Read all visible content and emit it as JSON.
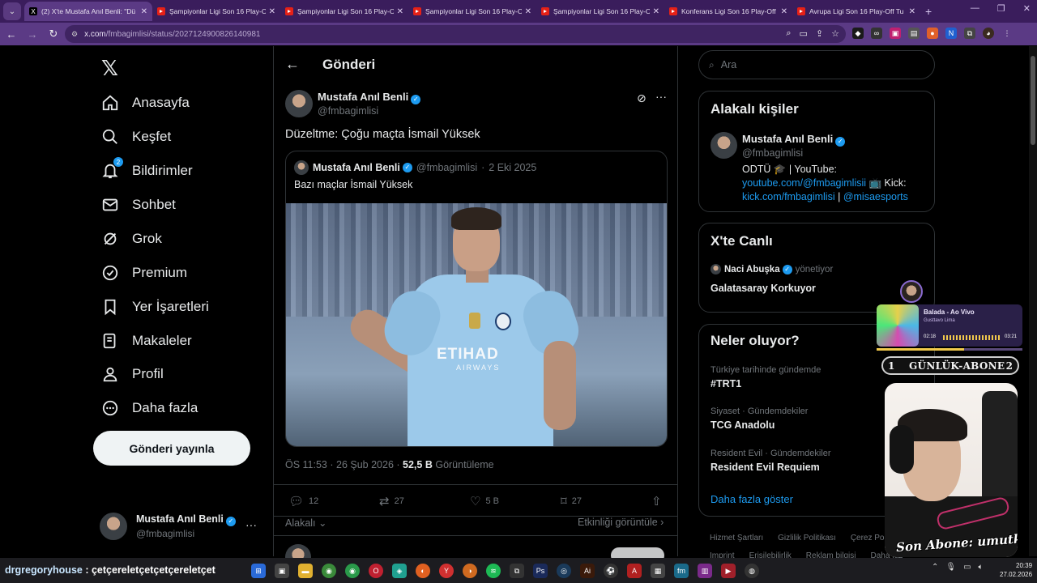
{
  "browser": {
    "tabs": [
      {
        "title": "(2) X'te Mustafa Anıl Benli: \"Dü",
        "favicon": "x-icon",
        "active": true
      },
      {
        "title": "Şampiyonlar Ligi Son 16 Play-O",
        "favicon": "youtube-icon",
        "active": false
      },
      {
        "title": "Şampiyonlar Ligi Son 16 Play-O",
        "favicon": "youtube-icon",
        "active": false
      },
      {
        "title": "Şampiyonlar Ligi Son 16 Play-O",
        "favicon": "youtube-icon",
        "active": false
      },
      {
        "title": "Şampiyonlar Ligi Son 16 Play-O",
        "favicon": "youtube-icon",
        "active": false
      },
      {
        "title": "Konferans Ligi Son 16 Play-Off",
        "favicon": "youtube-icon",
        "active": false
      },
      {
        "title": "Avrupa Ligi Son 16 Play-Off Tu",
        "favicon": "youtube-icon",
        "active": false
      }
    ],
    "url_host": "x.com",
    "url_path": "/fmbagimlisi/status/2027124900826140981",
    "colors": {
      "frame": "#3a1d5c",
      "toolbar": "#5b3a85"
    }
  },
  "nav": {
    "items": [
      {
        "label": "Anasayfa",
        "icon": "home-icon"
      },
      {
        "label": "Keşfet",
        "icon": "search-icon"
      },
      {
        "label": "Bildirimler",
        "icon": "bell-icon",
        "badge": "2"
      },
      {
        "label": "Sohbet",
        "icon": "mail-icon"
      },
      {
        "label": "Grok",
        "icon": "grok-icon"
      },
      {
        "label": "Premium",
        "icon": "premium-icon"
      },
      {
        "label": "Yer İşaretleri",
        "icon": "bookmark-icon"
      },
      {
        "label": "Makaleler",
        "icon": "articles-icon"
      },
      {
        "label": "Profil",
        "icon": "profile-icon"
      },
      {
        "label": "Daha fazla",
        "icon": "more-circle-icon"
      }
    ],
    "post_button": "Gönderi yayınla",
    "account": {
      "name": "Mustafa Anıl Benli",
      "handle": "@fmbagimlisi"
    }
  },
  "main": {
    "header_title": "Gönderi",
    "post": {
      "author_name": "Mustafa Anıl Benli",
      "author_handle": "@fmbagimlisi",
      "text": "Düzeltme: Çoğu maçta İsmail Yüksek",
      "quote": {
        "author_name": "Mustafa Anıl Benli",
        "author_handle": "@fmbagimlisi",
        "date": "2 Eki 2025",
        "text": "Bazı maçlar İsmail Yüksek",
        "photo_sponsor": "ETIHAD",
        "photo_sponsor_sub": "AIRWAYS"
      },
      "time": "ÖS 11:53 · 26 Şub 2026 ·",
      "views_count": "52,5 B",
      "views_label": "Görüntüleme",
      "stats": {
        "replies": "12",
        "reposts": "27",
        "likes": "5 B",
        "bookmarks": "27"
      },
      "related": "Alakalı",
      "activity": "Etkinliği görüntüle"
    }
  },
  "sidebar": {
    "search_placeholder": "Ara",
    "people": {
      "title": "Alakalı kişiler",
      "name": "Mustafa Anıl Benli",
      "handle": "@fmbagimlisi",
      "bio_1": "ODTÜ 🎓 | YouTube:",
      "bio_link_1": "youtube.com/@fmbagimlisii",
      "bio_2": " 📺 Kick:",
      "bio_link_2": "kick.com/fmbagimlisi",
      "bio_sep": " | ",
      "bio_link_3": "@misaesports"
    },
    "live": {
      "title": "X'te Canlı",
      "host": "Naci Abuşka",
      "role": "yönetiyor",
      "space_title": "Galatasaray Korkuyor"
    },
    "trends": {
      "title": "Neler oluyor?",
      "items": [
        {
          "context": "Türkiye tarihinde gündemde",
          "topic": "#TRT1"
        },
        {
          "context": "Siyaset · Gündemdekiler",
          "topic": "TCG Anadolu"
        },
        {
          "context": "Resident Evil · Gündemdekiler",
          "topic": "Resident Evil Requiem"
        }
      ],
      "show_more": "Daha fazla göster"
    },
    "footer": [
      "Hizmet Şartları",
      "Gizlilik Politikası",
      "Çerez Politik",
      "Imprint",
      "Erişilebilirlik",
      "Reklam bilgisi",
      "Daha faz"
    ]
  },
  "overlay": {
    "music": {
      "song": "Balada - Ao Vivo",
      "artist": "Gusttavo Lima",
      "elapsed": "02:18",
      "total": "03:21",
      "progress": 0.6
    },
    "subs": {
      "left": "1",
      "label": "GÜNLÜK-ABONE",
      "right": "2"
    },
    "last_sub": "Son Abone: umutkyn",
    "chat_user": "drgregoryhouse",
    "chat_message": " : çetçereletçetçetçereletçet"
  },
  "taskbar": {
    "time": "20:39",
    "date": "27.02.2026"
  }
}
